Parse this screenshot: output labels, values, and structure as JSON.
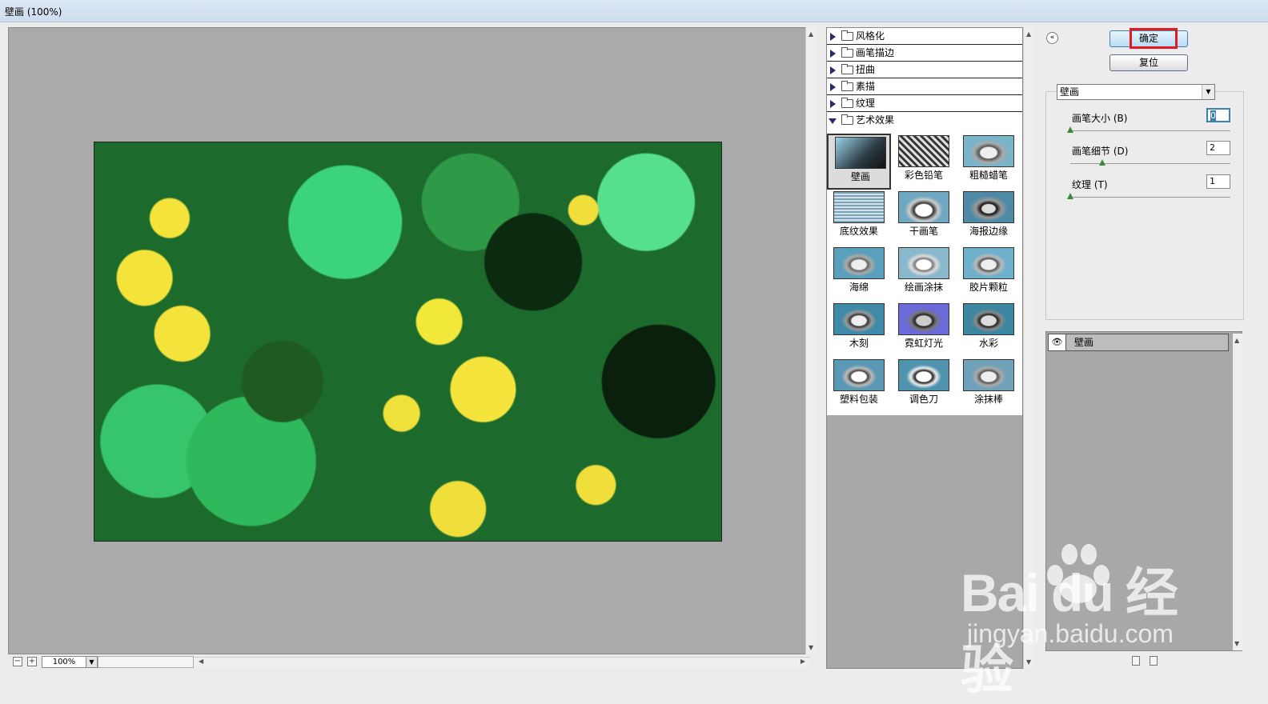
{
  "window": {
    "title": "壁画 (100%)"
  },
  "preview": {
    "zoom": "100%"
  },
  "filter_categories": [
    {
      "label": "风格化",
      "open": false
    },
    {
      "label": "画笔描边",
      "open": false
    },
    {
      "label": "扭曲",
      "open": false
    },
    {
      "label": "素描",
      "open": false
    },
    {
      "label": "纹理",
      "open": false
    },
    {
      "label": "艺术效果",
      "open": true
    }
  ],
  "filters": [
    {
      "label": "壁画",
      "selected": true
    },
    {
      "label": "彩色铅笔"
    },
    {
      "label": "粗糙蜡笔"
    },
    {
      "label": "底纹效果"
    },
    {
      "label": "干画笔"
    },
    {
      "label": "海报边缘"
    },
    {
      "label": "海绵"
    },
    {
      "label": "绘画涂抹"
    },
    {
      "label": "胶片颗粒"
    },
    {
      "label": "木刻"
    },
    {
      "label": "霓虹灯光"
    },
    {
      "label": "水彩"
    },
    {
      "label": "塑料包装"
    },
    {
      "label": "调色刀"
    },
    {
      "label": "涂抹棒"
    }
  ],
  "buttons": {
    "ok": "确定",
    "reset": "复位"
  },
  "selected_filter": "壁画",
  "params": [
    {
      "label": "画笔大小 (B)",
      "value": "0",
      "slider": 0.0
    },
    {
      "label": "画笔细节 (D)",
      "value": "2",
      "slider": 0.2
    },
    {
      "label": "纹理 (T)",
      "value": "1",
      "slider": 0.0
    }
  ],
  "layers": [
    {
      "label": "壁画",
      "visible": true
    }
  ],
  "watermark": {
    "logo_text": "Bai du 经验",
    "url": "jingyan.baidu.com"
  },
  "colors": {
    "accent": "#3c7fb1",
    "highlight": "#e21b22",
    "canvas_bg": "#aaaaaa"
  }
}
